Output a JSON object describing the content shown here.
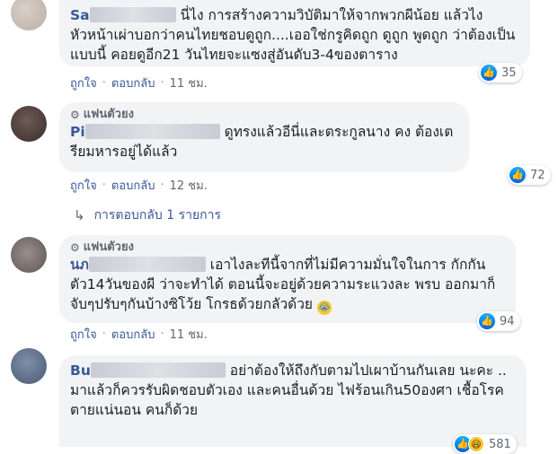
{
  "comments": [
    {
      "name_prefix": "Sa",
      "fan_label": "",
      "text": "นี่ไง การสร้างความวิบัติมาให้จากพวกผีน้อย แล้วไง หัวหน้าเผ่าบอกว่าคนไทยชอบดูถูก....เออใช่กรูคิดถูก ดูถูก พูดถูก ว่าต้องเป็นแบบนี้ คอยดูอีก21 วันไทยจะแซงสู่อันดับ3-4ของตาราง",
      "like": "ถูกใจ",
      "reply": "ตอบกลับ",
      "time": "11 ชม.",
      "reaction_count": "35"
    },
    {
      "name_prefix": "Pi",
      "fan_label": "แฟนตัวยง",
      "text": "ดูทรงแล้วอีนี่และตระกูลนาง คง ต้องเตรียมหารอยู่ได้แล้ว",
      "like": "ถูกใจ",
      "reply": "ตอบกลับ",
      "time": "12 ชม.",
      "reaction_count": "72",
      "replies_link": "การตอบกลับ 1 รายการ"
    },
    {
      "name_prefix": "นภ",
      "fan_label": "แฟนตัวยง",
      "text": "เอาไงละทีนี้จากที่ไม่มีความมั่นใจในการ กักกันตัว14วันของผี ว่าจะทำได้ ตอนนี้จะอยู่ด้วยความระแวงละ พรบ ออกมาก็จับๆปรับๆกันบ้างซิโว้ย โกรธด้วยกลัวด้วย",
      "like": "ถูกใจ",
      "reply": "ตอบกลับ",
      "time": "11 ชม.",
      "reaction_count": "94"
    },
    {
      "name_prefix": "Bu",
      "fan_label": "",
      "text": "อย่าต้องให้ถึงกับตามไปเผาบ้านกันเลย นะคะ .. มาแล้วก็ควรรับผิดชอบตัวเอง และคนอื่นด้วย ไฟร้อนเกิน50องศา เชื้อโรคตายแน่นอน คนก็ด้วย",
      "reaction_count": "581"
    }
  ],
  "separator": "·",
  "icons": {
    "like": "thumbs-up-icon",
    "haha": "haha-icon",
    "reply_arrow": "reply-arrow-icon",
    "fan_badge": "fan-badge-icon",
    "crying_emoji": "crying-emoji-icon"
  },
  "colors": {
    "link": "#385898",
    "bubble": "#f2f3f5",
    "meta": "#606770"
  }
}
